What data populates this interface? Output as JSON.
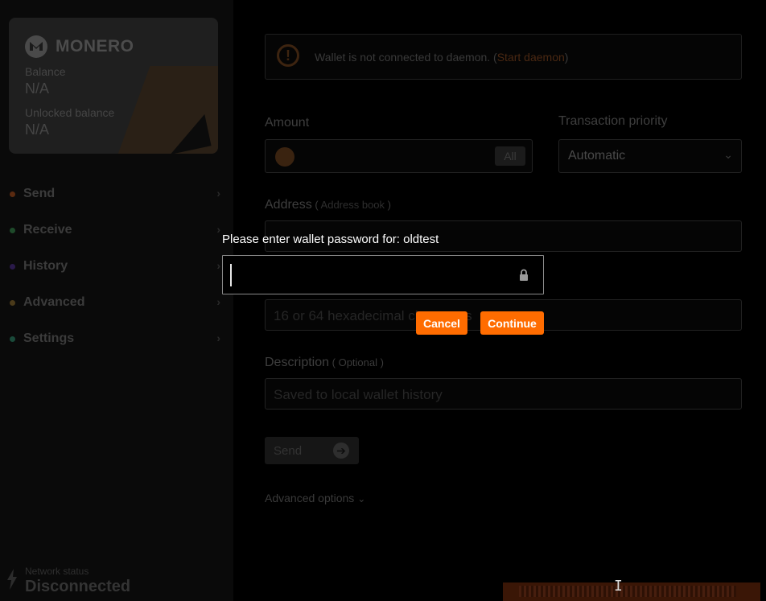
{
  "brand": {
    "name": "MONERO"
  },
  "balance": {
    "balance_label": "Balance",
    "balance_value": "N/A",
    "unlocked_label": "Unlocked balance",
    "unlocked_value": "N/A"
  },
  "nav": {
    "items": [
      {
        "label": "Send",
        "dot_color": "#5a2a10"
      },
      {
        "label": "Receive",
        "dot_color": "#1e4a2a"
      },
      {
        "label": "History",
        "dot_color": "#2a1a4a"
      },
      {
        "label": "Advanced",
        "dot_color": "#4a3a1a"
      },
      {
        "label": "Settings",
        "dot_color": "#1a4a3a"
      }
    ]
  },
  "network": {
    "label": "Network status",
    "value": "Disconnected"
  },
  "warning": {
    "text": "Wallet is not connected to daemon. (",
    "link": "Start daemon",
    "close": ")"
  },
  "form": {
    "amount_label": "Amount",
    "all_button": "All",
    "priority_label": "Transaction priority",
    "priority_value": "Automatic",
    "address_label": "Address",
    "address_book_open": " ( ",
    "address_book_link": "Address book",
    "address_book_close": " )",
    "payment_id_placeholder": "16 or 64 hexadecimal characters",
    "description_label": "Description",
    "description_optional": " ( Optional )",
    "description_placeholder": "Saved to local wallet history",
    "send_button": "Send",
    "advanced_options": "Advanced options"
  },
  "dialog": {
    "title": "Please enter wallet password for: oldtest",
    "password_value": "",
    "cancel_label": "Cancel",
    "continue_label": "Continue"
  },
  "colors": {
    "accent": "#ff6c00",
    "background": "#000000"
  }
}
